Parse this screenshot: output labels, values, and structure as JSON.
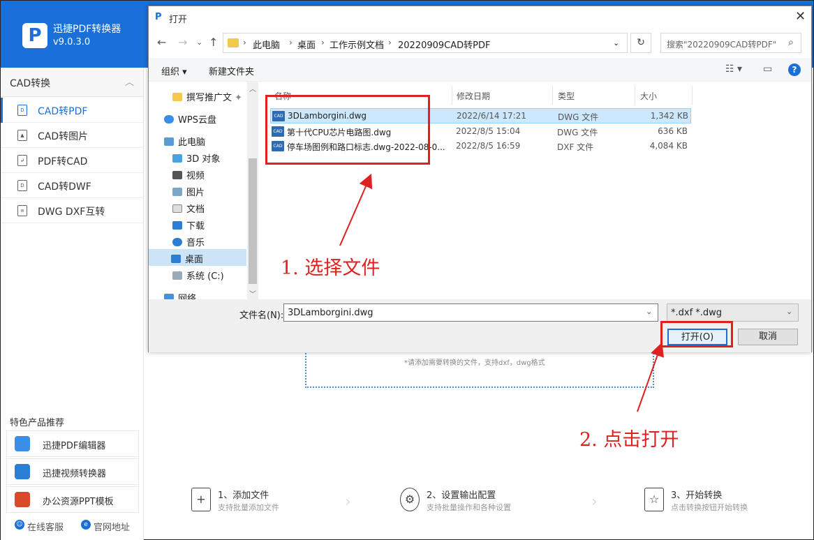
{
  "app": {
    "name": "迅捷PDF转换器",
    "version": "v9.0.3.0",
    "logo_letter": "P"
  },
  "sidebar": {
    "section": "CAD转换",
    "items": [
      {
        "label": "CAD转PDF",
        "active": true
      },
      {
        "label": "CAD转图片",
        "active": false
      },
      {
        "label": "PDF转CAD",
        "active": false
      },
      {
        "label": "CAD转DWF",
        "active": false
      },
      {
        "label": "DWG DXF互转",
        "active": false
      }
    ],
    "featured_title": "特色产品推荐",
    "promos": [
      "迅捷PDF编辑器",
      "迅捷视频转换器",
      "办公资源PPT模板"
    ],
    "footer": {
      "service": "在线客服",
      "website": "官网地址"
    }
  },
  "main": {
    "drop_hint": "*请添加需要转换的文件，支持dxf，dwg格式",
    "steps": [
      {
        "title": "1、添加文件",
        "sub": "支持批量添加文件"
      },
      {
        "title": "2、设置输出配置",
        "sub": "支持批量操作和各种设置"
      },
      {
        "title": "3、开始转换",
        "sub": "点击转换按钮开始转换"
      }
    ]
  },
  "dialog": {
    "title": "打开",
    "breadcrumb": [
      "此电脑",
      "桌面",
      "工作示例文档",
      "20220909CAD转PDF"
    ],
    "search_placeholder": "搜索\"20220909CAD转PDF\"",
    "toolbar": {
      "organize": "组织 ▾",
      "new_folder": "新建文件夹"
    },
    "nav": {
      "pinned": "撰写推广文",
      "wps": "WPS云盘",
      "pc": "此电脑",
      "items": [
        "3D 对象",
        "视频",
        "图片",
        "文档",
        "下载",
        "音乐",
        "桌面",
        "系统 (C:)"
      ],
      "network": "网络"
    },
    "columns": {
      "name": "名称",
      "date": "修改日期",
      "type": "类型",
      "size": "大小"
    },
    "files": [
      {
        "name": "3DLamborgini.dwg",
        "date": "2022/6/14 17:21",
        "type": "DWG 文件",
        "size": "1,342 KB",
        "selected": true
      },
      {
        "name": "第十代CPU芯片电路图.dwg",
        "date": "2022/8/5 15:04",
        "type": "DWG 文件",
        "size": "636 KB",
        "selected": false
      },
      {
        "name": "停车场图例和路口标志.dwg-2022-08-0...",
        "date": "2022/8/5 16:59",
        "type": "DXF 文件",
        "size": "4,084 KB",
        "selected": false
      }
    ],
    "filename_label": "文件名(N):",
    "filename_value": "3DLamborgini.dwg",
    "filetype": "*.dxf *.dwg",
    "open_button": "打开(O)",
    "cancel_button": "取消",
    "file_icon_text": "CAD"
  },
  "annotations": {
    "step1": "1. 选择文件",
    "step2": "2. 点击打开"
  },
  "colors": {
    "brand": "#1a6fd8",
    "annotation": "#e02020",
    "selection": "#cce8ff"
  }
}
